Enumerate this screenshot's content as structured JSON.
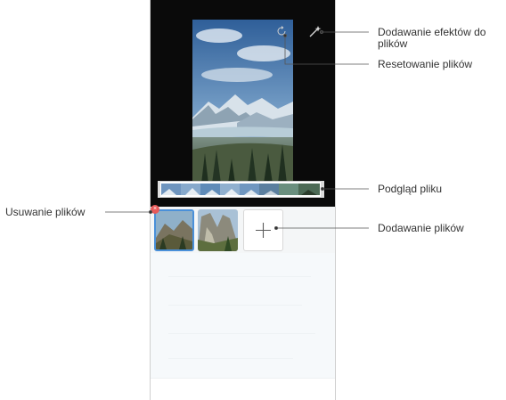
{
  "callouts": {
    "effects": "Dodawanie efektów do plików",
    "effects_line1": "Dodawanie efektów do",
    "effects_line2": "plików",
    "reset": "Resetowanie plików",
    "preview": "Podgląd pliku",
    "add": "Dodawanie plików",
    "delete": "Usuwanie plików"
  },
  "screen": {
    "top_left": "",
    "effects_label": "",
    "cancel": "",
    "done": ""
  },
  "icons": {
    "reset": "reset-icon",
    "effects": "magic-wand-icon",
    "add": "plus-icon",
    "delete": "close-icon"
  },
  "colors": {
    "delete_badge": "#e85a5a",
    "selected_border": "#4a90d9",
    "accent_text": "#7fbde8"
  }
}
